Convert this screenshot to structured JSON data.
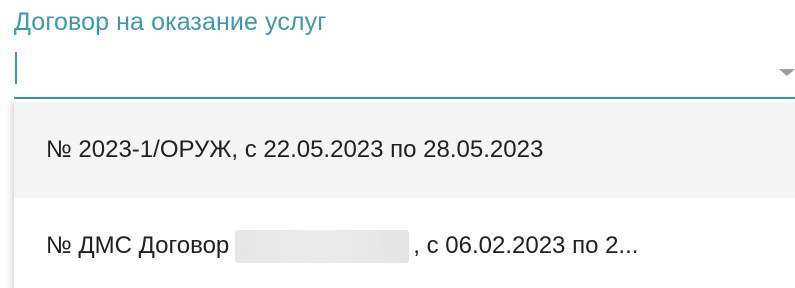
{
  "field": {
    "label": "Договор на оказание услуг",
    "value": ""
  },
  "dropdown": {
    "options": [
      {
        "label": "№ 2023-1/ОРУЖ, с 22.05.2023 по 28.05.2023"
      },
      {
        "label_prefix": "№ ДМС Договор",
        "label_suffix": ", с 06.02.2023 по 2..."
      }
    ]
  },
  "colors": {
    "accent": "#3f97b1",
    "text": "#212121",
    "hover_background": "#f5f5f5"
  },
  "icons": {
    "dropdown_arrow": "arrow-drop-down-icon"
  }
}
